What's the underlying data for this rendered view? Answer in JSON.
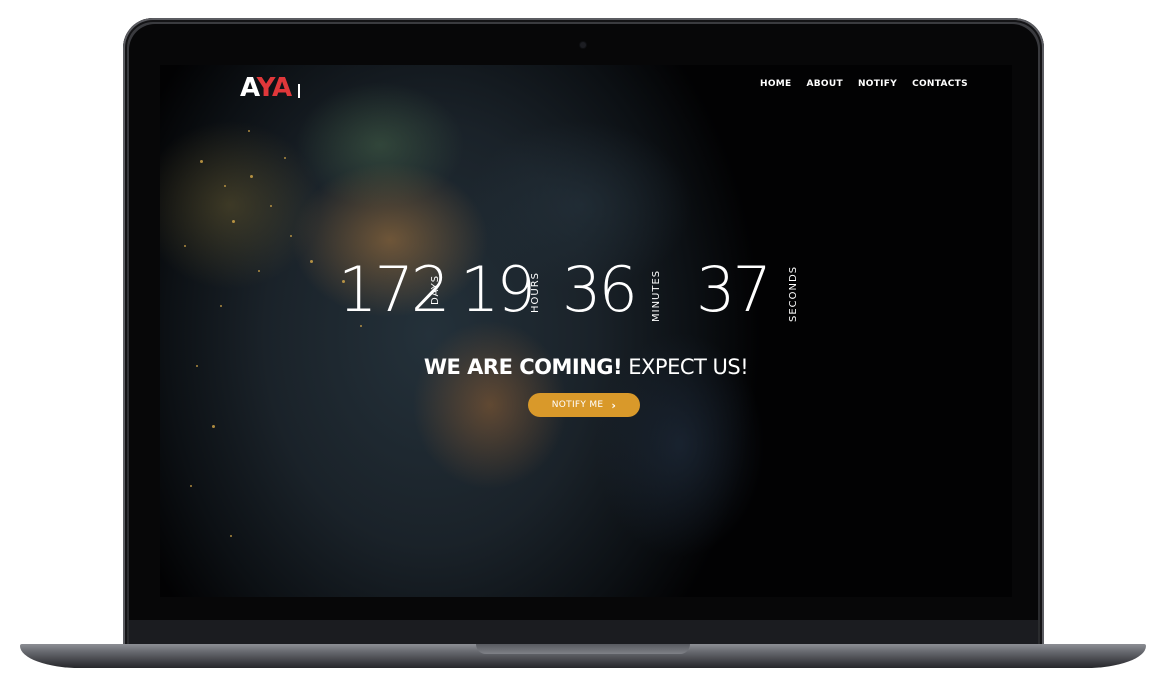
{
  "brand": {
    "logo_a": "A",
    "logo_ya": "YA",
    "logo_red": "#e0373a"
  },
  "nav": {
    "items": [
      {
        "label": "HOME"
      },
      {
        "label": "ABOUT"
      },
      {
        "label": "NOTIFY"
      },
      {
        "label": "CONTACTS"
      }
    ]
  },
  "countdown": {
    "days": "172",
    "days_label": "DAYS",
    "hours": "19",
    "hours_label": "HOURS",
    "minutes": "36",
    "minutes_label": "MINUTES",
    "seconds": "37",
    "seconds_label": "SECONDS"
  },
  "hero": {
    "headline_bold": "WE ARE COMING!",
    "headline_light": "EXPECT US!",
    "cta_label": "NOTIFY ME",
    "cta_icon": "chevron-right-icon",
    "cta_color": "#d9992a"
  }
}
